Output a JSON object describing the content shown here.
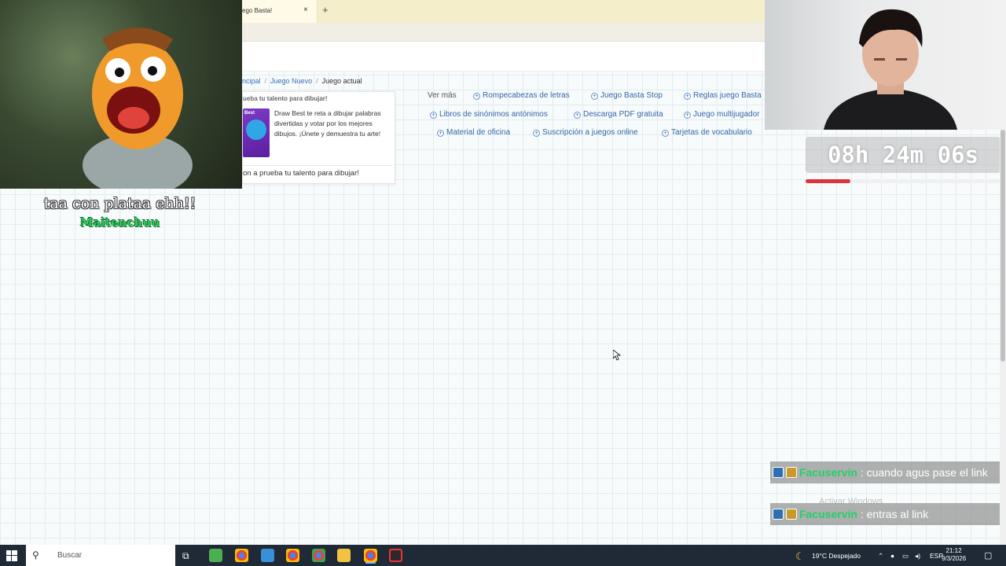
{
  "browser": {
    "tab_title": "ego Basta!",
    "tab_close": "×",
    "tab_new": "+"
  },
  "breadcrumb": {
    "items": [
      "ncipal",
      "Juego Nuevo",
      "Juego actual"
    ],
    "separator": "/"
  },
  "card": {
    "heading": "ueba tu talento para dibujar!",
    "image_tag": "Best",
    "description": "Draw Best te reta a dibujar palabras divertidas y votar por los mejores dibujos. ¡Únete y demuestra tu arte!",
    "button_label": "on a prueba tu talento para dibujar!"
  },
  "related_links": {
    "more_label": "Ver más",
    "items": [
      "Rompecabezas de letras",
      "Juego Basta Stop",
      "Reglas juego Basta",
      "Libros de sinónimos antónimos",
      "Descarga PDF gratuita",
      "Juego multijugador",
      "Material de oficina",
      "Suscripción a juegos online",
      "Tarjetas de vocabulario"
    ]
  },
  "overlay": {
    "timer": "08h 24m 06s",
    "timer_progress": 0.23,
    "caption_text": "taa con plataa ehh!!",
    "caption_user": "Maitenchuu"
  },
  "chat": [
    {
      "user": "Facuservin",
      "message": " : cuando agus pase el link"
    },
    {
      "user": "Facuservin",
      "message": " : entras al link"
    }
  ],
  "watermark": "Activar Windows",
  "taskbar": {
    "search_placeholder": "Buscar",
    "weather": "19°C  Despejado",
    "language": "ESP",
    "time": "21:12",
    "date": "9/3/2026"
  },
  "colors": {
    "link": "#3566a8",
    "timer_bar": "#e0343d",
    "chat_user": "#23d06a",
    "tab_bar": "#f5eecb"
  }
}
